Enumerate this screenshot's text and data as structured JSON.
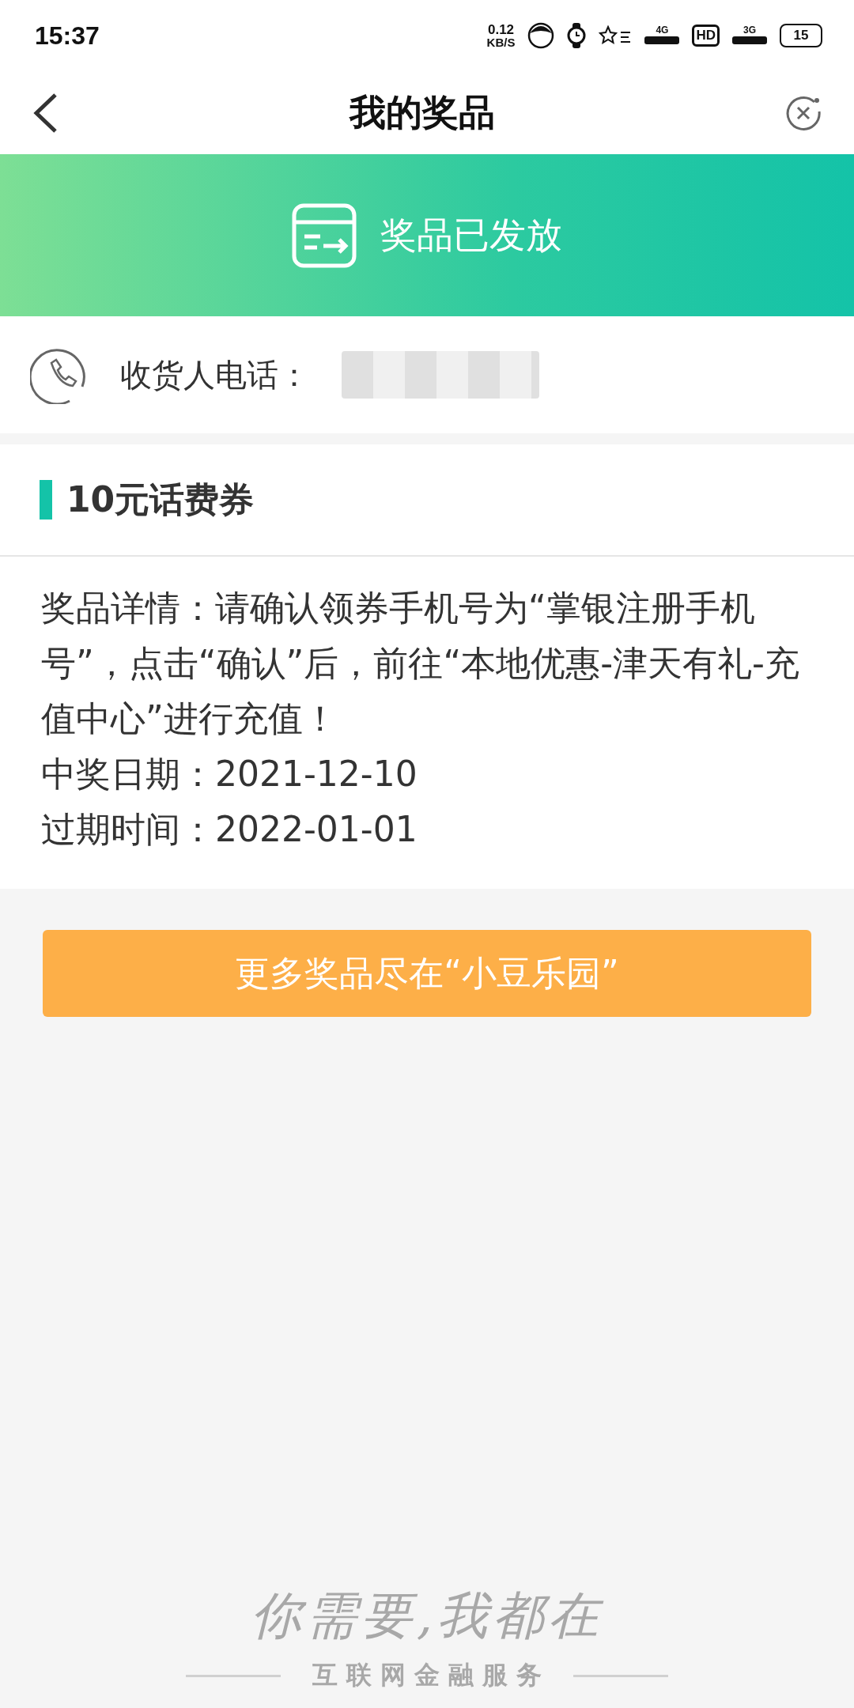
{
  "status_bar": {
    "time": "15:37",
    "net_speed": "0.12",
    "net_unit": "KB/S",
    "hd": "HD",
    "network_1": "4G",
    "network_2": "3G",
    "battery": "15"
  },
  "header": {
    "title": "我的奖品"
  },
  "banner": {
    "text": "奖品已发放"
  },
  "contact": {
    "label": "收货人电话："
  },
  "prize": {
    "title": "10元话费券",
    "details": [
      "奖品详情：请确认领券手机号为“掌银注册手机号”，点击“确认”后，前往“本地优惠-津天有礼-充值中心”进行充值！",
      "中奖日期：2021-12-10",
      "过期时间：2022-01-01"
    ]
  },
  "more_button": {
    "label": "更多奖品尽在“小豆乐园”"
  },
  "footer": {
    "slogan": "你需要,我都在",
    "tagline": "互 联 网 金 融 服 务"
  }
}
